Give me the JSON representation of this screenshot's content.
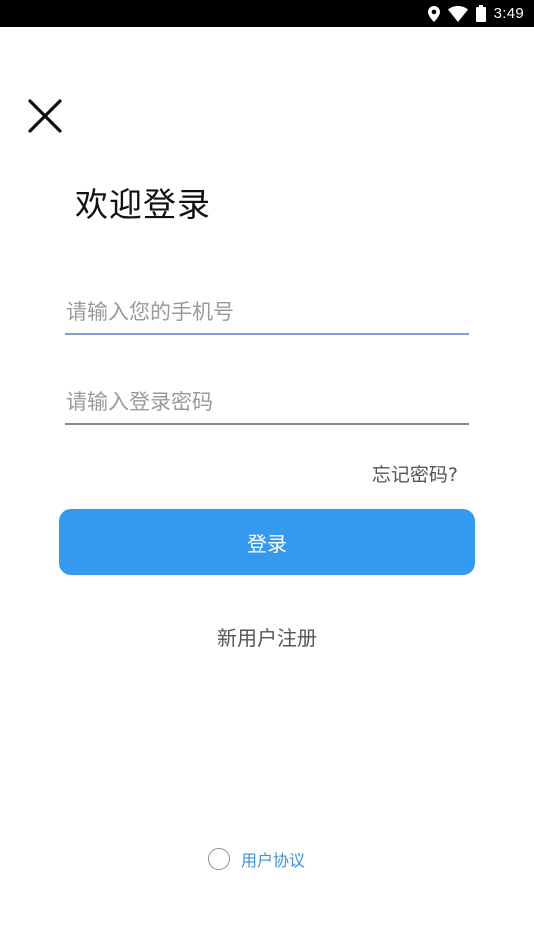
{
  "status_bar": {
    "time": "3:49",
    "icons": [
      "location-icon",
      "wifi-icon",
      "battery-icon"
    ]
  },
  "header": {
    "close_icon": "close-icon",
    "title": "欢迎登录"
  },
  "form": {
    "phone": {
      "placeholder": "请输入您的手机号",
      "value": ""
    },
    "password": {
      "placeholder": "请输入登录密码",
      "value": ""
    },
    "forgot_label": "忘记密码?",
    "login_label": "登录",
    "register_label": "新用户注册"
  },
  "agreement": {
    "checked": false,
    "label": "用户协议"
  },
  "colors": {
    "primary": "#3399f1",
    "link": "#3d8ee0",
    "active_underline": "#7b9fd6",
    "status_bar": "#000000"
  }
}
